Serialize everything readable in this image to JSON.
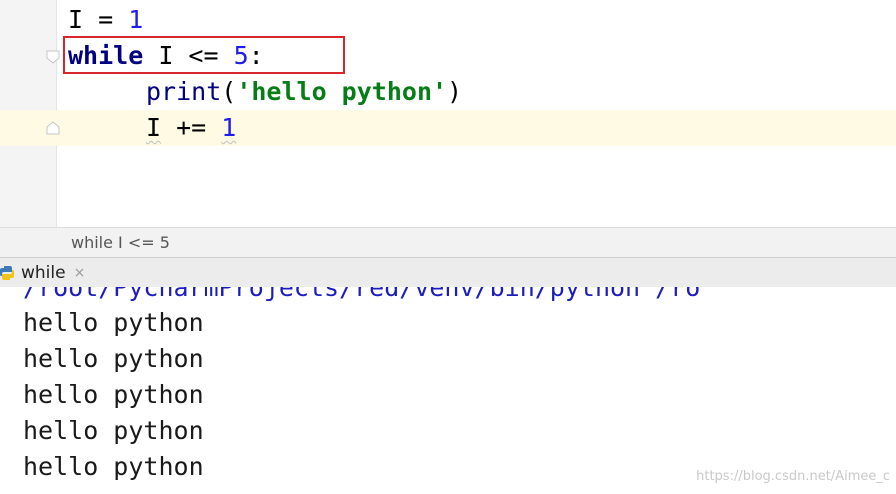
{
  "editor": {
    "lines": {
      "l1": {
        "var": "I",
        "op": " = ",
        "num": "1"
      },
      "l2": {
        "kw": "while",
        "var": " I <= ",
        "num": "5",
        "colon": ":"
      },
      "l3": {
        "fn": "print",
        "open": "(",
        "str": "'hello python'",
        "close": ")"
      },
      "l4": {
        "var": "I",
        "op": " += ",
        "num": "1"
      }
    }
  },
  "breadcrumb": "while I <= 5",
  "run_panel": {
    "tab_label": "while",
    "close_glyph": "×",
    "command": "/root/PycharmProjects/red/venv/bin/python /ro",
    "output": [
      "hello python",
      "hello python",
      "hello python",
      "hello python",
      "hello python"
    ]
  },
  "watermark": "https://blog.csdn.net/Aimee_c",
  "colors": {
    "highlight_box": "#d8262b",
    "keyword": "#000080",
    "number": "#1c1cf0",
    "string": "#067d17"
  },
  "icons": [
    "fold-icon",
    "python-icon",
    "close-icon"
  ]
}
